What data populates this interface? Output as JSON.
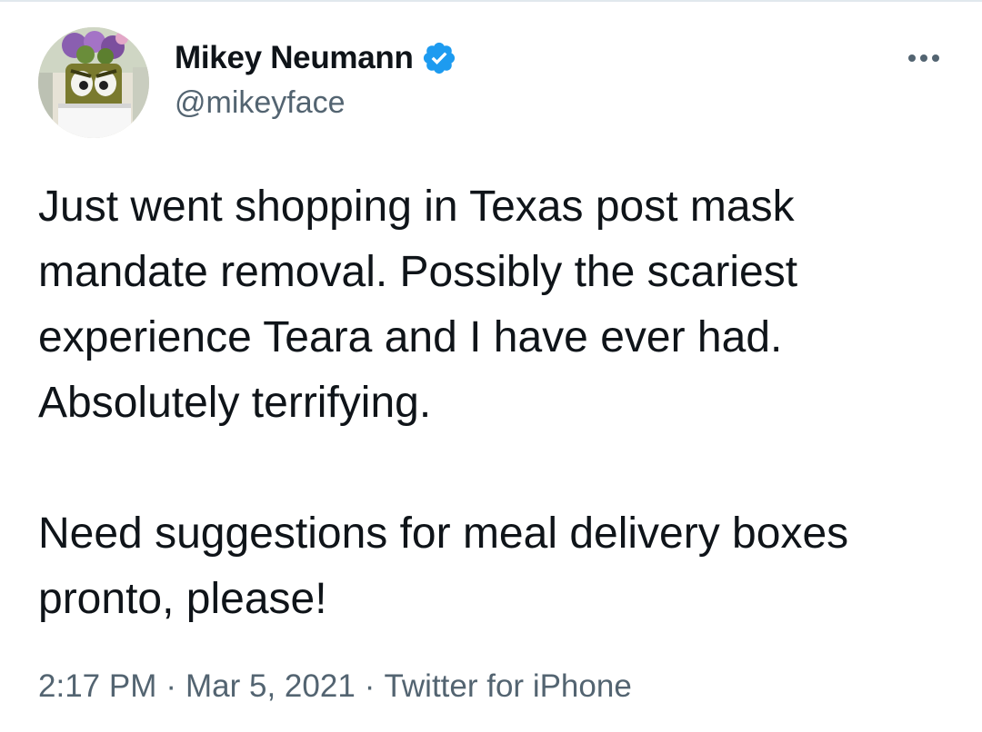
{
  "author": {
    "display_name": "Mikey Neumann",
    "handle": "@mikeyface",
    "verified": true,
    "avatar_icon": "profile-avatar"
  },
  "tweet": {
    "paragraphs": [
      "Just went shopping in Texas post mask mandate removal. Possibly the scariest experience Teara and I have ever had. Absolutely terrifying.",
      "Need suggestions for meal delivery boxes pronto, please!"
    ]
  },
  "meta": {
    "time": "2:17 PM",
    "separator": "·",
    "date": "Mar 5, 2021",
    "source": "Twitter for iPhone"
  },
  "icons": {
    "verified": "verified-badge-icon",
    "more": "more-horizontal-icon"
  },
  "colors": {
    "verified_blue": "#1d9bf0",
    "secondary_text": "#536471",
    "primary_text": "#0f1419"
  }
}
